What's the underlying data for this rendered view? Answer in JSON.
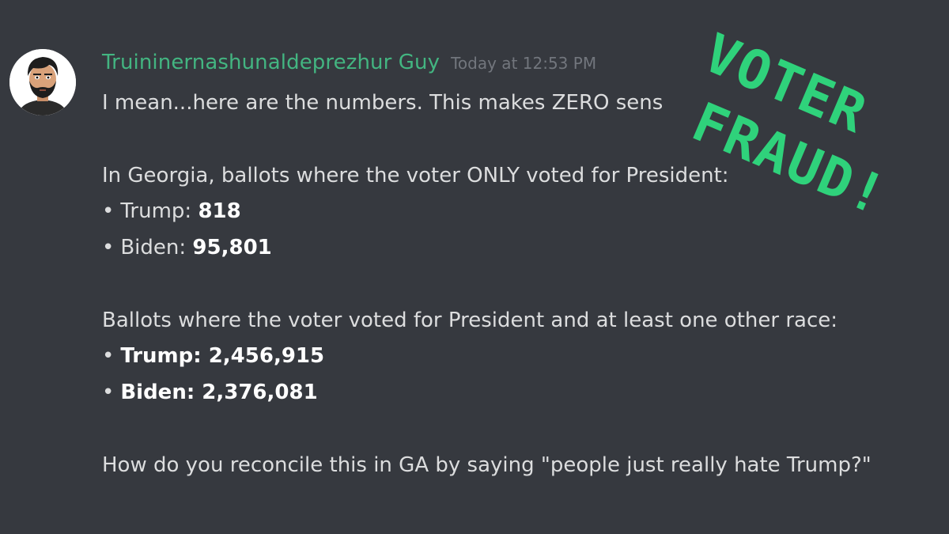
{
  "message": {
    "username": "Truininernashunaldeprezhur Guy",
    "timestamp": "Today at 12:53 PM",
    "lines": {
      "intro": "I mean...here are the numbers. This makes ZERO sens",
      "georgia_heading": "In Georgia, ballots where the voter ONLY voted for President:",
      "only_trump_label": "Trump: ",
      "only_trump_value": "818",
      "only_biden_label": "Biden: ",
      "only_biden_value": "95,801",
      "other_heading": "Ballots where the voter voted for President and at least one other race:",
      "other_trump": "Trump: 2,456,915",
      "other_biden": "Biden: 2,376,081",
      "closing": "How do you reconcile this in GA by saying \"people just really hate Trump?\""
    },
    "bullet": "•"
  },
  "overlay": {
    "line1": "VOTER",
    "line2": "FRAUD!",
    "color": "#2fd27b"
  },
  "colors": {
    "background": "#36393f",
    "username": "#43b581",
    "timestamp": "#72767d",
    "text": "#dcddde"
  }
}
